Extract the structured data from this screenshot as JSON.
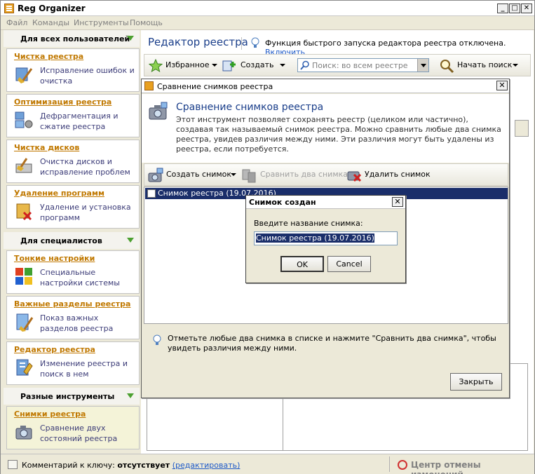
{
  "app": {
    "title": "Reg Organizer"
  },
  "menu": [
    "Файл",
    "Команды",
    "Инструменты",
    "Помощь"
  ],
  "window_buttons": {
    "minimize": "_",
    "maximize": "□",
    "close": "✕"
  },
  "sidebar": {
    "sections": [
      {
        "title": "Для всех пользователей",
        "items": [
          {
            "title": "Чистка реестра",
            "desc": "Исправление ошибок и очистка"
          },
          {
            "title": "Оптимизация реестра",
            "desc": "Дефрагментация и сжатие реестра"
          },
          {
            "title": "Чистка дисков",
            "desc": "Очистка дисков и исправление проблем"
          },
          {
            "title": "Удаление программ",
            "desc": "Удаление и установка программ"
          }
        ]
      },
      {
        "title": "Для специалистов",
        "items": [
          {
            "title": "Тонкие настройки",
            "desc": "Специальные настройки системы"
          },
          {
            "title": "Важные разделы реестра",
            "desc": "Показ важных разделов реестра"
          },
          {
            "title": "Редактор реестра",
            "desc": "Изменение реестра и поиск в нем"
          }
        ]
      },
      {
        "title": "Разные инструменты",
        "items": [
          {
            "title": "Снимки реестра",
            "desc": "Сравнение двух состояний реестра"
          }
        ]
      }
    ]
  },
  "main": {
    "title": "Редактор реестра",
    "notice": "Функция быстрого запуска редактора реестра отключена.",
    "notice_link": "Включить",
    "toolbar": {
      "favorites": "Избранное",
      "create": "Создать",
      "search_placeholder": "Поиск: во всем реестре",
      "start_search": "Начать поиск"
    }
  },
  "status": {
    "comment_label": "Комментарий к ключу:",
    "comment_value": "отсутствует",
    "edit_link": "(редактировать)",
    "undo_center": "Центр отмены изменений"
  },
  "snapshot_dialog": {
    "title": "Сравнение снимков реестра",
    "header_title": "Сравнение снимков реестра",
    "header_desc": "Этот инструмент позволяет сохранять реестр (целиком или частично), создавая так называемый снимок реестра. Можно сравнить любые два снимка реестра, увидев различия между ними. Эти различия могут быть удалены из реестра, если потребуется.",
    "toolbar": {
      "create": "Создать снимок",
      "compare": "Сравнить два снимка",
      "delete": "Удалить снимок"
    },
    "snapshots": [
      {
        "label": "Снимок реестра (19.07.2016)",
        "checked": false
      }
    ],
    "hint": "Отметьте любые два снимка в списке и нажмите \"Сравнить два снимка\", чтобы увидеть различия между ними.",
    "close_button": "Закрыть"
  },
  "name_prompt": {
    "title": "Снимок создан",
    "label": "Введите название снимка:",
    "value": "Снимок реестра (19.07.2016)",
    "ok": "OK",
    "cancel": "Cancel"
  },
  "colors": {
    "accent": "#1a3e8a",
    "link": "#1e5ac8",
    "card_title": "#c07800",
    "selection": "#1a2e6a"
  }
}
